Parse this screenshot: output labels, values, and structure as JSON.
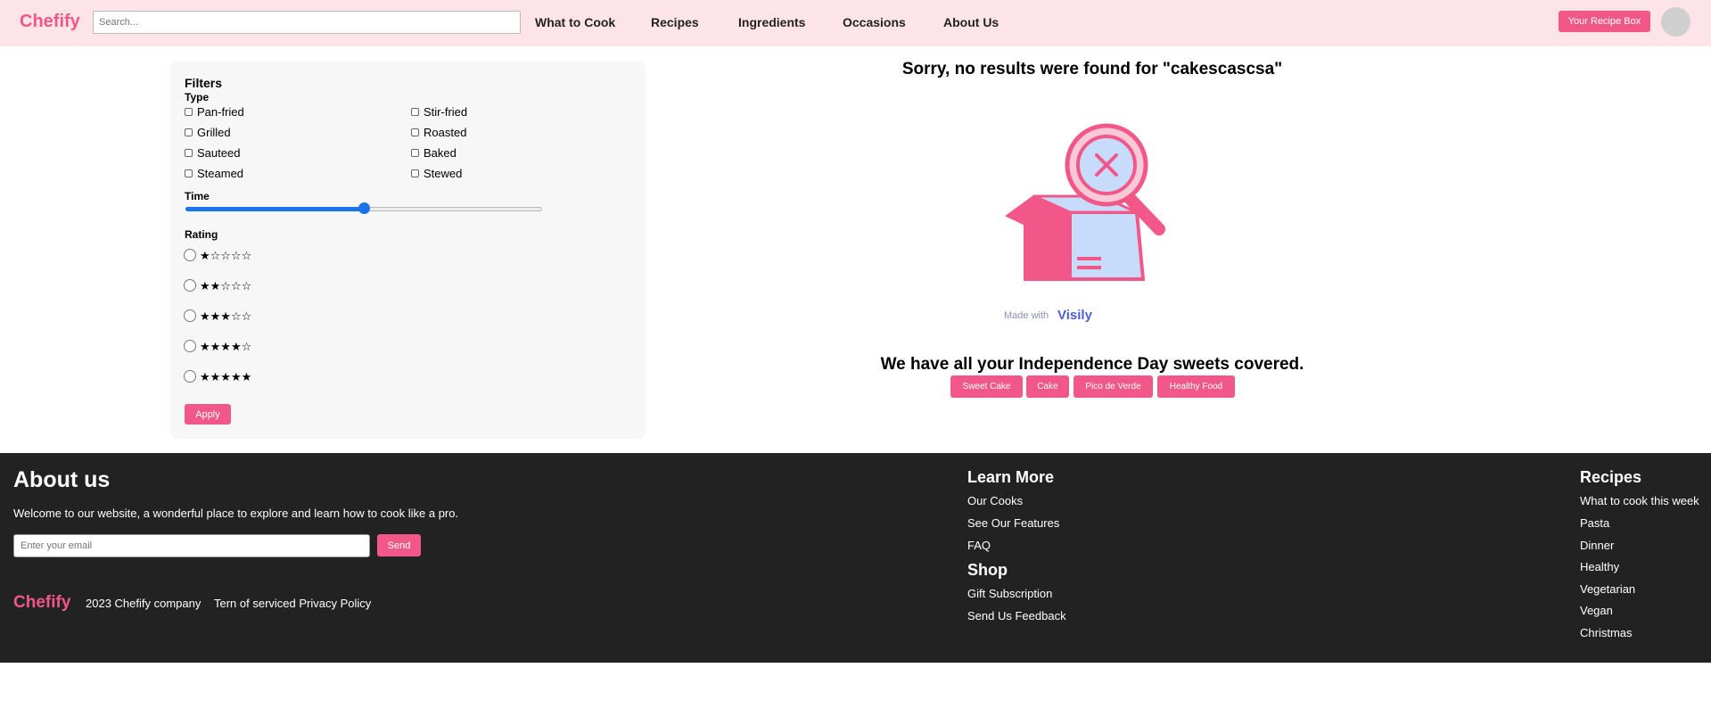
{
  "header": {
    "brand": "Chefify",
    "search_placeholder": "Search...",
    "nav": [
      "What to Cook",
      "Recipes",
      "Ingredients",
      "Occasions",
      "About Us"
    ],
    "recipe_box_label": "Your Recipe Box"
  },
  "filters": {
    "title": "Filters",
    "type_label": "Type",
    "types": [
      "Pan-fried",
      "Stir-fried",
      "Grilled",
      "Roasted",
      "Sauteed",
      "Baked",
      "Steamed",
      "Stewed"
    ],
    "time_label": "Time",
    "time_value_fraction": 0.5,
    "rating_label": "Rating",
    "ratings": [
      "★☆☆☆☆",
      "★★☆☆☆",
      "★★★☆☆",
      "★★★★☆",
      "★★★★★"
    ],
    "apply_label": "Apply"
  },
  "results": {
    "no_results_text": "Sorry, no results were found for \"cakescascsa\"",
    "made_with": "Made with",
    "made_with_brand": "Visily",
    "cover_text": "We have all your Independence Day sweets covered.",
    "tags": [
      "Sweet Cake",
      "Cake",
      "Pico de Verde",
      "Healthy Food"
    ]
  },
  "footer": {
    "about_title": "About us",
    "welcome": "Welcome to our website, a wonderful place to explore and learn how to cook like a pro.",
    "email_placeholder": "Enter your email",
    "send_label": "Send",
    "brand": "Chefify",
    "copyright": "2023 Chefify company",
    "terms": "Tern of serviced Privacy Policy",
    "learn_more_title": "Learn More",
    "learn_more_links": [
      "Our Cooks",
      "See Our Features",
      "FAQ"
    ],
    "shop_title": "Shop",
    "shop_links": [
      "Gift Subscription",
      "Send Us Feedback"
    ],
    "recipes_title": "Recipes",
    "recipes_links": [
      "What to cook this week",
      "Pasta",
      "Dinner",
      "Healthy",
      "Vegetarian",
      "Vegan",
      "Christmas"
    ]
  },
  "colors": {
    "accent": "#f2578a",
    "header_bg": "#fde4e8",
    "footer_bg": "#222222",
    "slider": "#1a73e8"
  }
}
